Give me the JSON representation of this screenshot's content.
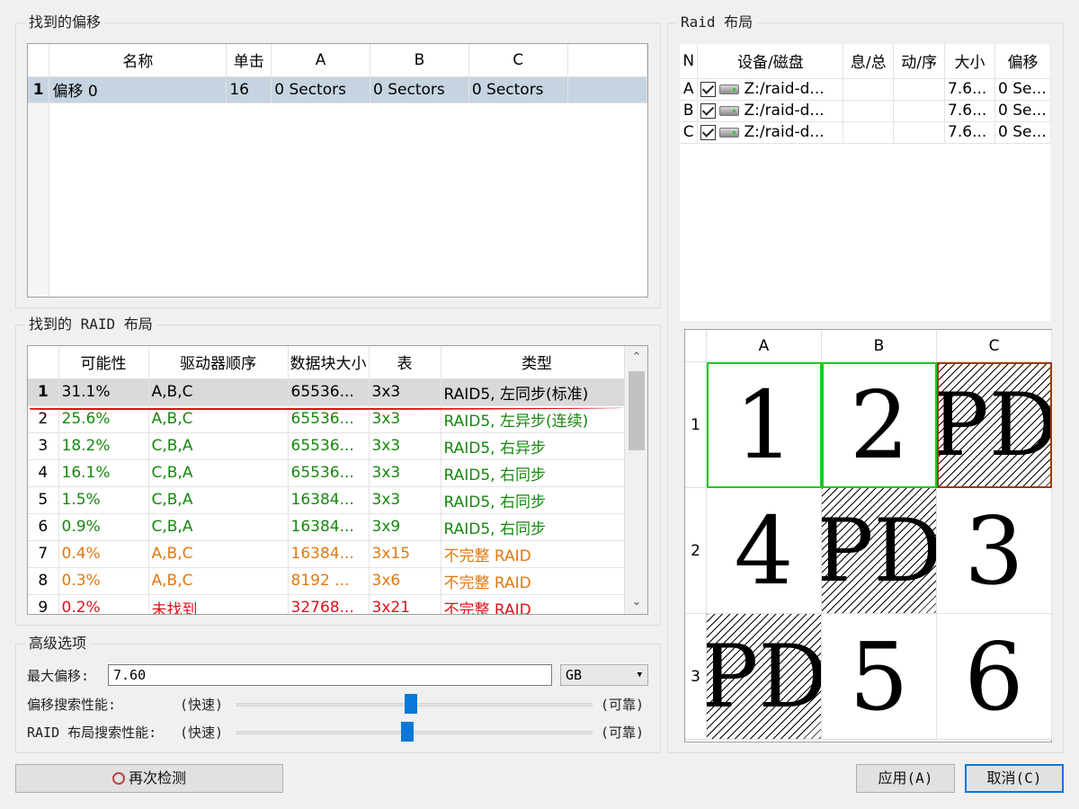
{
  "offsets_panel": {
    "title": "找到的偏移",
    "columns": [
      "名称",
      "单击",
      "A",
      "B",
      "C"
    ],
    "rows": [
      {
        "num": "1",
        "name": "偏移 0",
        "click": "16",
        "a": "0 Sectors",
        "b": "0 Sectors",
        "c": "0 Sectors"
      }
    ]
  },
  "layouts_panel": {
    "title": "找到的 RAID 布局",
    "columns": [
      "可能性",
      "驱动器顺序",
      "数据块大小",
      "表",
      "类型"
    ],
    "rows": [
      {
        "num": "1",
        "prob": "31.1%",
        "order": "A,B,C",
        "block": "65536...",
        "table": "3x3",
        "type": "RAID5, 左同步(标准)",
        "color": "black"
      },
      {
        "num": "2",
        "prob": "25.6%",
        "order": "A,B,C",
        "block": "65536...",
        "table": "3x3",
        "type": "RAID5, 左异步(连续)",
        "color": "green"
      },
      {
        "num": "3",
        "prob": "18.2%",
        "order": "C,B,A",
        "block": "65536...",
        "table": "3x3",
        "type": "RAID5, 右异步",
        "color": "green"
      },
      {
        "num": "4",
        "prob": "16.1%",
        "order": "C,B,A",
        "block": "65536...",
        "table": "3x3",
        "type": "RAID5, 右同步",
        "color": "green"
      },
      {
        "num": "5",
        "prob": "1.5%",
        "order": "C,B,A",
        "block": "16384...",
        "table": "3x3",
        "type": "RAID5, 右同步",
        "color": "green"
      },
      {
        "num": "6",
        "prob": "0.9%",
        "order": "C,B,A",
        "block": "16384...",
        "table": "3x9",
        "type": "RAID5, 右同步",
        "color": "green"
      },
      {
        "num": "7",
        "prob": "0.4%",
        "order": "A,B,C",
        "block": "16384...",
        "table": "3x15",
        "type": "不完整 RAID",
        "color": "orange"
      },
      {
        "num": "8",
        "prob": "0.3%",
        "order": "A,B,C",
        "block": "8192 ...",
        "table": "3x6",
        "type": "不完整 RAID",
        "color": "orange"
      },
      {
        "num": "9",
        "prob": "0.2%",
        "order": "未找到",
        "block": "32768...",
        "table": "3x21",
        "type": "不完整 RAID",
        "color": "red"
      }
    ],
    "scroll_up": "⌃",
    "scroll_down": "⌄"
  },
  "raid_layout_panel": {
    "title": "Raid 布局",
    "columns": [
      "N",
      "设备/磁盘",
      "息/总",
      "动/序",
      "大小",
      "偏移"
    ],
    "rows": [
      {
        "letter": "A",
        "device": "Z:/raid-d...",
        "size": "7.6...",
        "offset": "0 Se..."
      },
      {
        "letter": "B",
        "device": "Z:/raid-d...",
        "size": "7.6...",
        "offset": "0 Se..."
      },
      {
        "letter": "C",
        "device": "Z:/raid-d...",
        "size": "7.6...",
        "offset": "0 Se..."
      }
    ]
  },
  "diagram": {
    "columns": [
      "A",
      "B",
      "C"
    ],
    "row_labels": [
      "1",
      "2",
      "3"
    ],
    "cells": [
      [
        {
          "text": "1",
          "parity": false,
          "outline": "green"
        },
        {
          "text": "2",
          "parity": false,
          "outline": "green"
        },
        {
          "text": "PD",
          "parity": true,
          "outline": "brown"
        }
      ],
      [
        {
          "text": "4",
          "parity": false,
          "outline": ""
        },
        {
          "text": "PD",
          "parity": true,
          "outline": ""
        },
        {
          "text": "3",
          "parity": false,
          "outline": ""
        }
      ],
      [
        {
          "text": "PD",
          "parity": true,
          "outline": ""
        },
        {
          "text": "5",
          "parity": false,
          "outline": ""
        },
        {
          "text": "6",
          "parity": false,
          "outline": ""
        }
      ]
    ]
  },
  "advanced": {
    "title": "高级选项",
    "max_offset_label": "最大偏移:",
    "max_offset_value": "7.60",
    "unit": "GB",
    "offset_search_label": "偏移搜索性能:",
    "raid_search_label": "RAID 布局搜索性能:",
    "fast": "(快速)",
    "reliable": "(可靠)",
    "offset_slider_fraction": 0.49,
    "raid_slider_fraction": 0.48
  },
  "buttons": {
    "redetect": "再次检测",
    "apply": "应用(A)",
    "cancel": "取消(C)"
  }
}
